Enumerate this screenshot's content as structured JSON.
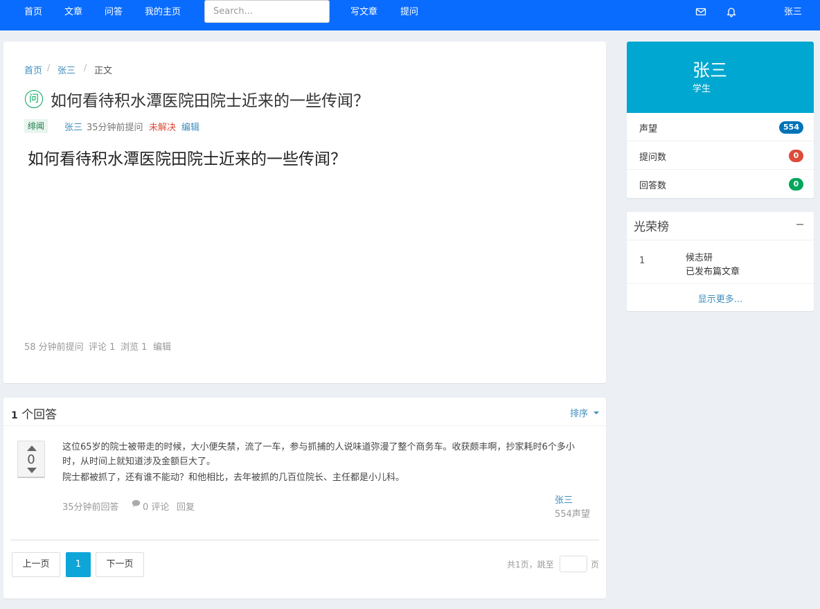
{
  "nav": {
    "home": "首页",
    "articles": "文章",
    "qa": "问答",
    "my_home": "我的主页",
    "search_placeholder": "Search...",
    "write_article": "写文章",
    "ask": "提问",
    "user": "张三"
  },
  "breadcrumb": {
    "home": "首页",
    "user": "张三",
    "current": "正文"
  },
  "question": {
    "badge": "问",
    "title": "如何看待积水潭医院田院士近来的一些传闻？",
    "tag": "绯闻",
    "author": "张三",
    "time": "35分钟前提问",
    "status": "未解决",
    "edit": "编辑",
    "body": "如何看待积水潭医院田院士近来的一些传闻？",
    "footer": {
      "asked": "58 分钟前提问",
      "comments": "评论 1",
      "views": "浏览 1",
      "edit": "编辑"
    }
  },
  "answers": {
    "count": "1",
    "count_label": "个回答",
    "sort": "排序",
    "items": [
      {
        "votes": "0",
        "paragraph1": "这位65岁的院士被带走的时候，大小便失禁，流了一车，参与抓捕的人说味道弥漫了整个商务车。收获颇丰啊，抄家耗时6个多小时，从时间上就知道涉及金额巨大了。",
        "paragraph2": "院士都被抓了，还有谁不能动？和他相比，去年被抓的几百位院长、主任都是小儿科。",
        "time": "35分钟前回答",
        "comments": "0 评论",
        "reply": "回复",
        "user": "张三",
        "reputation": "554声望"
      }
    ]
  },
  "pagination": {
    "prev": "上一页",
    "current": "1",
    "next": "下一页",
    "total": "共1页，跳至",
    "page_unit": "页"
  },
  "profile": {
    "name": "张三",
    "role": "学生",
    "stats": [
      {
        "label": "声望",
        "value": "554",
        "color": "#0073b7"
      },
      {
        "label": "提问数",
        "value": "0",
        "color": "#dd4b39"
      },
      {
        "label": "回答数",
        "value": "0",
        "color": "#00a65a"
      }
    ]
  },
  "fame": {
    "title": "光荣榜",
    "rank": "1",
    "name": "候志研",
    "desc": "已发布篇文章",
    "more": "显示更多..."
  },
  "colors": {
    "nav": "#0a6cff",
    "accent": "#00a7d0",
    "link": "#3c8dbc"
  },
  "icons": {
    "mail": "envelope-icon",
    "bell": "bell-icon",
    "comment": "comment-icon"
  }
}
